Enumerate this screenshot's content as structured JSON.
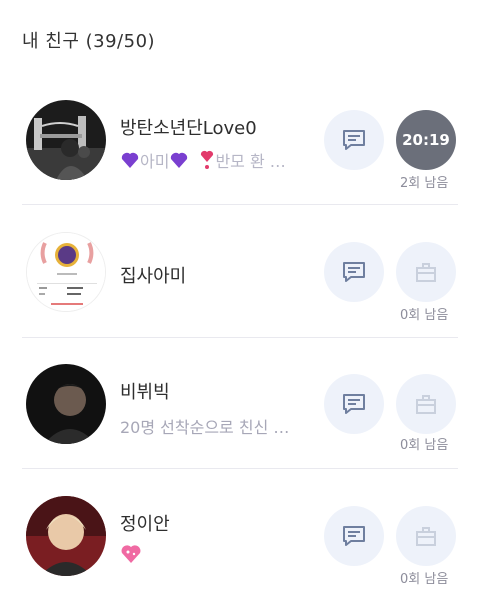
{
  "header": {
    "title": "내 친구 (39/50)"
  },
  "friends": [
    {
      "name": "방탄소년단Love0",
      "status": "아미",
      "status2": "반모 환 …",
      "timer": "20:19",
      "remaining": "2회 남음"
    },
    {
      "name": "집사아미",
      "status": "",
      "remaining": "0회 남음"
    },
    {
      "name": "비뷔빅",
      "status": "20명 선착순으로 친신 …",
      "remaining": "0회 남음"
    },
    {
      "name": "정이안",
      "status": "",
      "remaining": "0회 남음"
    }
  ],
  "icons": {
    "message": "message-icon",
    "gift": "gift-icon"
  },
  "colors": {
    "button_bg": "#eef2fa",
    "icon_active": "#6f7f9f",
    "icon_disabled": "#c9d0dd",
    "timer_bg": "#6b6f7a"
  }
}
